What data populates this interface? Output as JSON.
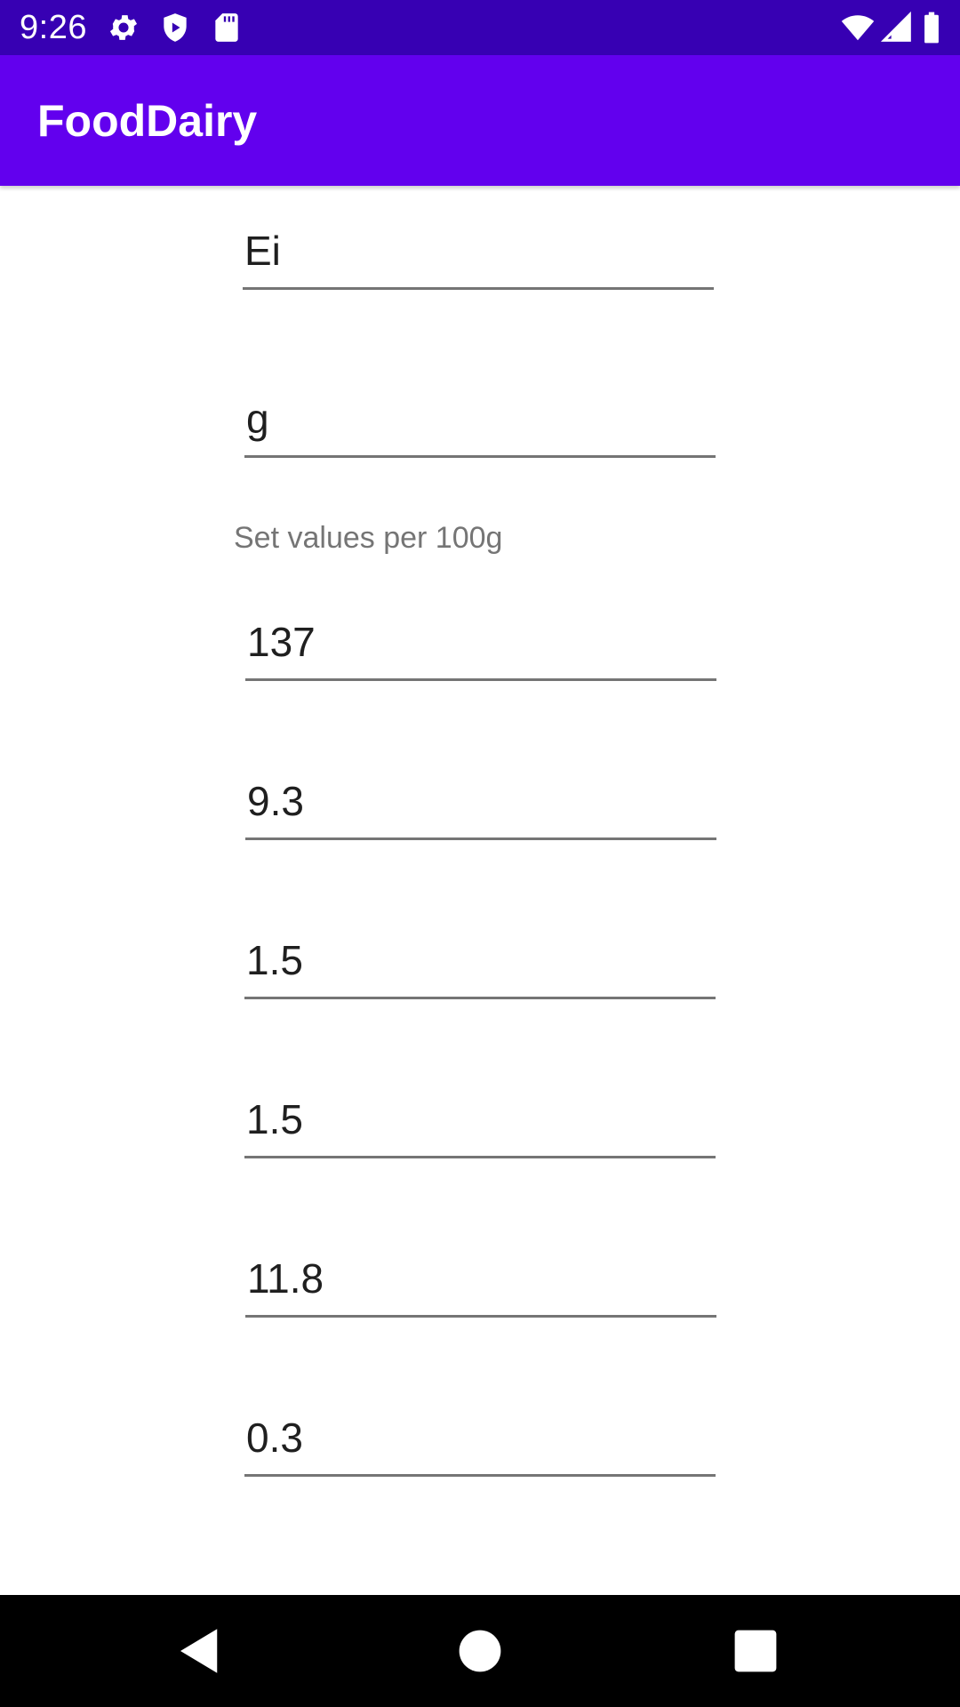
{
  "status_bar": {
    "time": "9:26",
    "icons": [
      "settings-gear-icon",
      "shield-play-icon",
      "sd-card-icon",
      "wifi-icon",
      "cell-signal-icon",
      "battery-icon"
    ],
    "color": "#3700b3"
  },
  "app_bar": {
    "title": "FoodDairy",
    "color": "#6200ee"
  },
  "form": {
    "name_value": "Ei",
    "unit_value": "g",
    "hint": "Set values per 100g",
    "calories_value": "137",
    "protein_value": "9.3",
    "carbs_value": "1.5",
    "sugar_value": "1.5",
    "fat_value": "11.8",
    "salt_value": "0.3"
  },
  "nav_bar": {
    "icons": [
      "back-icon",
      "home-icon",
      "recents-icon"
    ]
  }
}
